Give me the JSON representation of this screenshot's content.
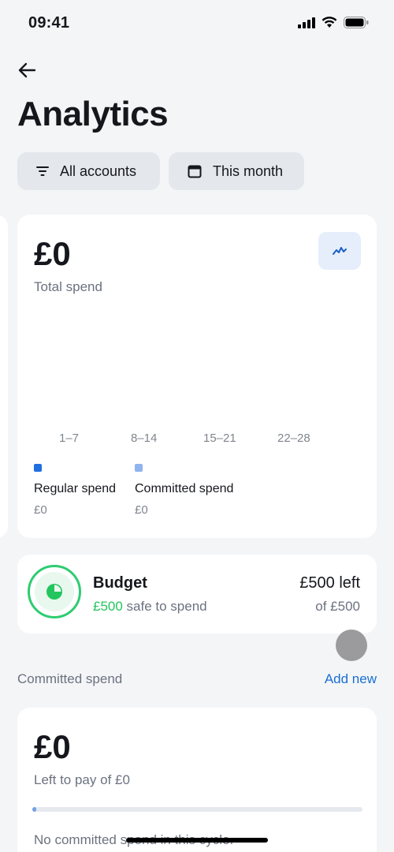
{
  "status_bar": {
    "time": "09:41",
    "icons": [
      "signal-icon",
      "wifi-icon",
      "battery-icon"
    ]
  },
  "header": {
    "back_icon": "arrow-left-icon",
    "title": "Analytics"
  },
  "filters": {
    "accounts_label": "All accounts",
    "accounts_icon": "filter-icon",
    "period_label": "This month",
    "period_icon": "calendar-icon"
  },
  "spend_card": {
    "amount": "£0",
    "label": "Total spend",
    "toggle_icon": "line-chart-icon",
    "chart_data": {
      "type": "bar",
      "categories": [
        "1–7",
        "8–14",
        "15–21",
        "22–28"
      ],
      "series": [
        {
          "name": "Regular spend",
          "values": [
            0,
            0,
            0,
            0
          ],
          "color": "#1f6fe0"
        },
        {
          "name": "Committed spend",
          "values": [
            0,
            0,
            0,
            0
          ],
          "color": "#8fb4ef"
        }
      ]
    },
    "legend": [
      {
        "label": "Regular spend",
        "value": "£0",
        "color": "#1f6fe0"
      },
      {
        "label": "Committed spend",
        "value": "£0",
        "color": "#8fb4ef"
      }
    ]
  },
  "budget": {
    "icon": "pie-chart-icon",
    "title": "Budget",
    "safe_amount": "£500",
    "safe_label": " safe to spend",
    "left_label": "£500 left",
    "of_label": "of £500",
    "ring_color": "#2ecc71"
  },
  "committed": {
    "section_title": "Committed spend",
    "add_label": "Add new",
    "amount": "£0",
    "label": "Left to pay of £0",
    "progress": 0,
    "empty_text": "No committed spend in this cycle."
  },
  "colors": {
    "accent": "#1a6fd1",
    "green": "#22c55e",
    "background": "#f4f5f7"
  }
}
